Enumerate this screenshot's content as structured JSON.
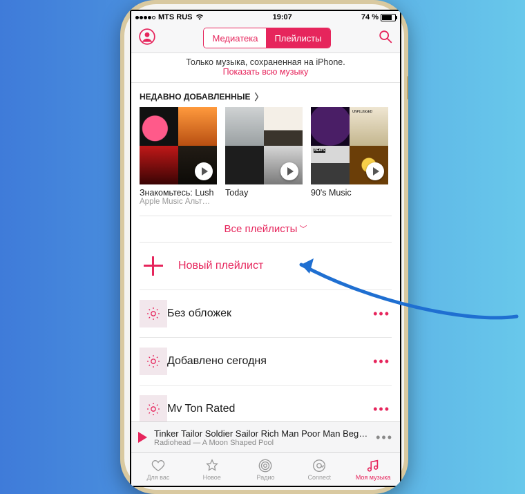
{
  "colors": {
    "accent": "#e6255c"
  },
  "status": {
    "carrier": "MTS RUS",
    "time": "19:07",
    "battery_pct": "74 %"
  },
  "nav": {
    "tab_library": "Медиатека",
    "tab_playlists": "Плейлисты"
  },
  "banner": {
    "line1": "Только музыка, сохраненная на iPhone.",
    "line2": "Показать всю музыку"
  },
  "recently_added": {
    "header": "НЕДАВНО ДОБАВЛЕННЫЕ",
    "items": [
      {
        "title": "Знакомьтесь: Lush",
        "subtitle": "Apple Music Альт…"
      },
      {
        "title": "Today",
        "subtitle": ""
      },
      {
        "title": "90's Music",
        "subtitle": ""
      }
    ]
  },
  "all_playlists_label": "Все плейлисты",
  "new_playlist_label": "Новый плейлист",
  "playlists": [
    {
      "label": "Без обложек"
    },
    {
      "label": "Добавлено сегодня"
    },
    {
      "label": "Mv Ton Rated"
    }
  ],
  "now_playing": {
    "title": "Tinker Tailor Soldier Sailor Rich Man Poor Man Begg…",
    "subtitle": "Radiohead — A Moon Shaped Pool"
  },
  "tabs": {
    "for_you": "Для вас",
    "new": "Новое",
    "radio": "Радио",
    "connect": "Connect",
    "my_music": "Моя музыка"
  }
}
